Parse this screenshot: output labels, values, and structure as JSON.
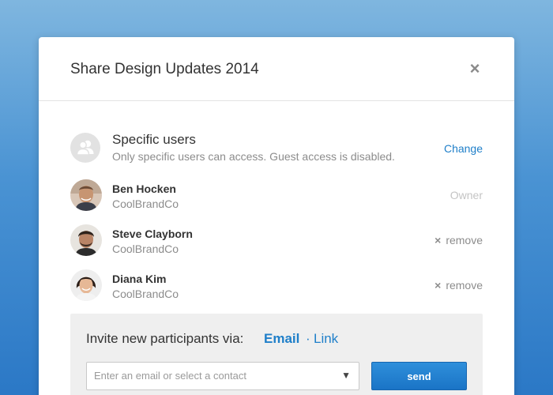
{
  "dialog": {
    "title": "Share Design Updates 2014",
    "close_icon": "close-icon",
    "close_glyph": "×"
  },
  "access": {
    "icon": "users-group-icon",
    "title": "Specific users",
    "description": "Only specific users can access. Guest access is disabled.",
    "change_label": "Change"
  },
  "users": [
    {
      "name": "Ben Hocken",
      "company": "CoolBrandCo",
      "role": "Owner"
    },
    {
      "name": "Steve Clayborn",
      "company": "CoolBrandCo",
      "action": "remove"
    },
    {
      "name": "Diana Kim",
      "company": "CoolBrandCo",
      "action": "remove"
    }
  ],
  "remove_glyph": "×",
  "invite": {
    "label": "Invite new participants via:",
    "email_label": "Email",
    "separator": "·",
    "link_label": "Link",
    "contact_placeholder": "Enter an email or select a contact",
    "dropdown_arrow": "▼",
    "send_label": "send"
  },
  "colors": {
    "accent": "#1f7fc9",
    "send_button": "#2384d1",
    "background_top": "#7fb6df",
    "background_bottom": "#2b78c6"
  }
}
